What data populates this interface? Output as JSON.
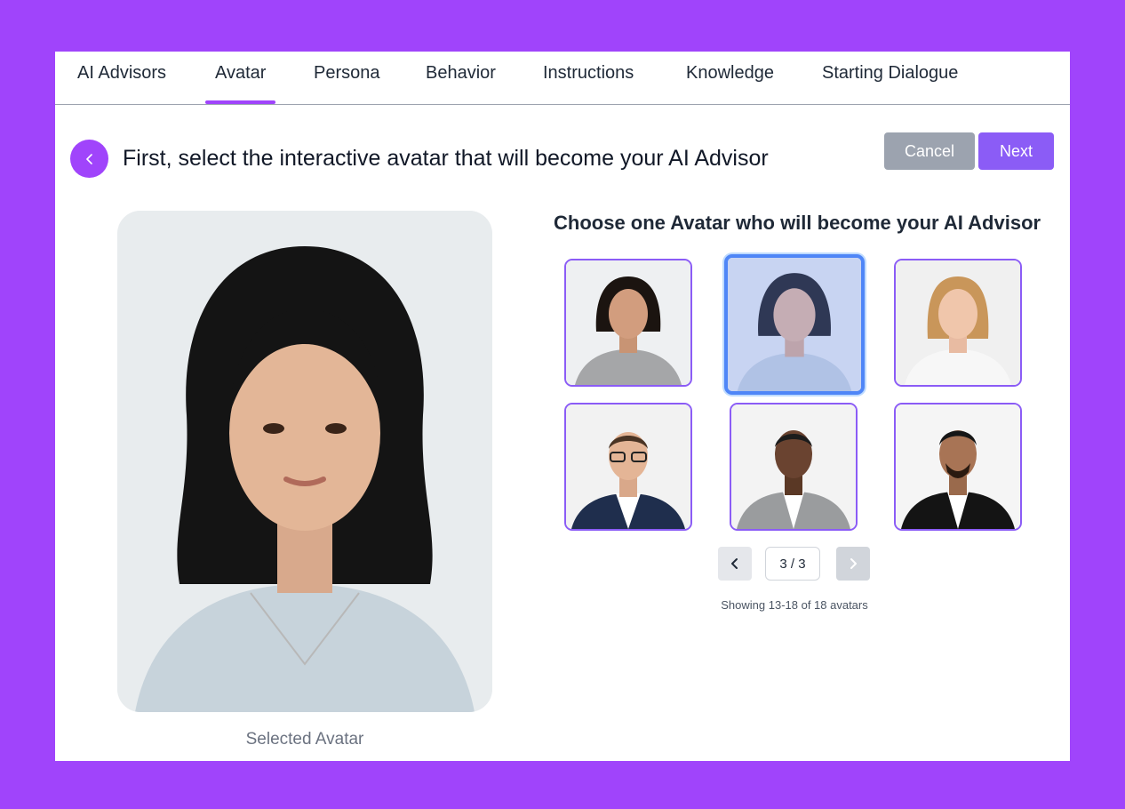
{
  "tabs": [
    {
      "label": "AI Advisors",
      "active": false
    },
    {
      "label": "Avatar",
      "active": true
    },
    {
      "label": "Persona",
      "active": false
    },
    {
      "label": "Behavior",
      "active": false
    },
    {
      "label": "Instructions",
      "active": false
    },
    {
      "label": "Knowledge",
      "active": false
    },
    {
      "label": "Starting Dialogue",
      "active": false
    }
  ],
  "header": {
    "back_icon": "chevron-left-icon",
    "title": "First, select the interactive avatar that will become your AI Advisor",
    "cancel_label": "Cancel",
    "next_label": "Next"
  },
  "selected_avatar": {
    "caption": "Selected Avatar"
  },
  "chooser": {
    "title": "Choose one Avatar who will become your AI Advisor",
    "avatars": [
      {
        "name": "avatar-1",
        "selected": false
      },
      {
        "name": "avatar-2",
        "selected": true
      },
      {
        "name": "avatar-3",
        "selected": false
      },
      {
        "name": "avatar-4",
        "selected": false
      },
      {
        "name": "avatar-5",
        "selected": false
      },
      {
        "name": "avatar-6",
        "selected": false
      }
    ]
  },
  "pagination": {
    "prev_icon": "chevron-left-icon",
    "next_icon": "chevron-right-icon",
    "indicator": "3 / 3",
    "showing": "Showing 13-18 of 18 avatars"
  },
  "colors": {
    "brand": "#a044fb",
    "accent": "#8b5cf6",
    "cancel": "#9ca3af",
    "selected_ring": "#4f86f7"
  }
}
